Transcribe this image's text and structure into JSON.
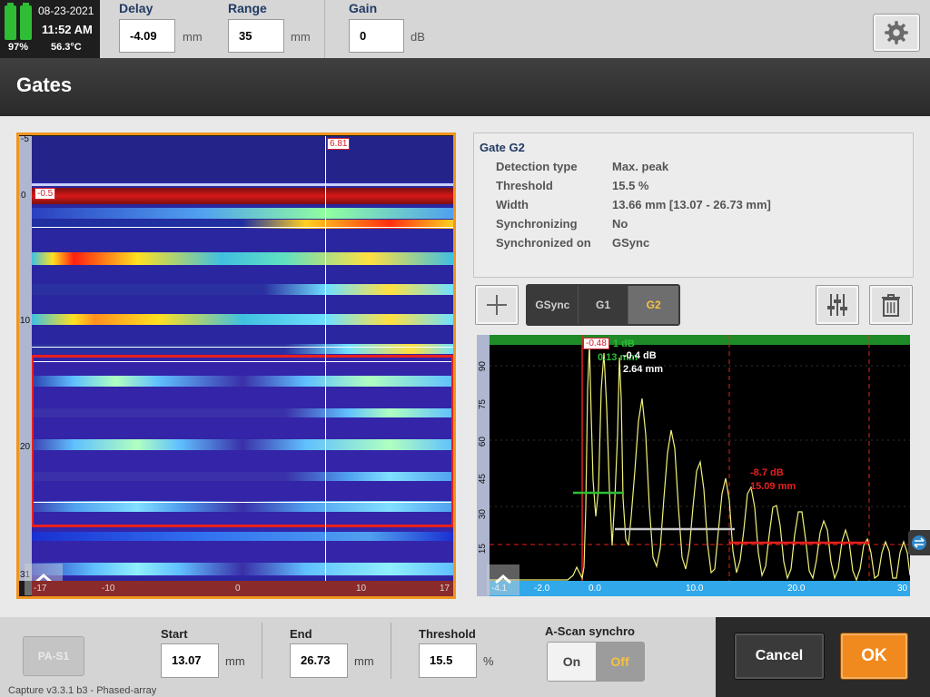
{
  "status": {
    "date": "08-23-2021",
    "time": "11:52 AM",
    "battery": "97%",
    "temperature": "56.3°C"
  },
  "toolbar": {
    "delay": {
      "label": "Delay",
      "value": "-4.09",
      "unit": "mm"
    },
    "range": {
      "label": "Range",
      "value": "35",
      "unit": "mm"
    },
    "gain": {
      "label": "Gain",
      "value": "0",
      "unit": "dB"
    },
    "settings_icon": "gear-icon"
  },
  "page_title": "Gates",
  "bscan": {
    "cursor_label": "6.81",
    "gate_label": "-0.5",
    "v_ticks": [
      "-5",
      "0",
      "10",
      "20",
      "31"
    ],
    "h_ticks": [
      "-17",
      "-10",
      "0",
      "10",
      "17"
    ]
  },
  "gate_info": {
    "title": "Gate G2",
    "rows": [
      {
        "key": "Detection type",
        "value": "Max. peak"
      },
      {
        "key": "Threshold",
        "value": "15.5 %"
      },
      {
        "key": "Width",
        "value": "13.66 mm [13.07 - 26.73 mm]"
      },
      {
        "key": "Synchronizing",
        "value": "No"
      },
      {
        "key": "Synchronized on",
        "value": "GSync"
      }
    ]
  },
  "gate_tabs": [
    "GSync",
    "G1",
    "G2"
  ],
  "selected_gate": "G2",
  "ascan": {
    "cursor_label": "-0.48",
    "g1_db": "1 dB",
    "g1_mm": "0.13 mm",
    "w_db": "-0.4 dB",
    "w_mm": "2.64 mm",
    "g2_db": "-8.7 dB",
    "g2_mm": "15.09 mm",
    "v_ticks": [
      "90",
      "75",
      "60",
      "45",
      "30",
      "15"
    ],
    "h_ticks": [
      "-4.1",
      "-2.0",
      "0.0",
      "10.0",
      "20.0",
      "30"
    ]
  },
  "bottom": {
    "probe": "PA-S1",
    "start": {
      "label": "Start",
      "value": "13.07",
      "unit": "mm"
    },
    "end": {
      "label": "End",
      "value": "26.73",
      "unit": "mm"
    },
    "threshold": {
      "label": "Threshold",
      "value": "15.5",
      "unit": "%"
    },
    "ascan_synchro": {
      "label": "A-Scan synchro",
      "on": "On",
      "off": "Off",
      "selected": "Off"
    },
    "cancel": "Cancel",
    "ok": "OK",
    "version": "Capture v3.3.1 b3 - Phased-array"
  },
  "colors": {
    "accent": "#f09520",
    "gate_red": "#e0201e",
    "gate_green": "#2ebd35",
    "signal": "#f2f27a"
  }
}
